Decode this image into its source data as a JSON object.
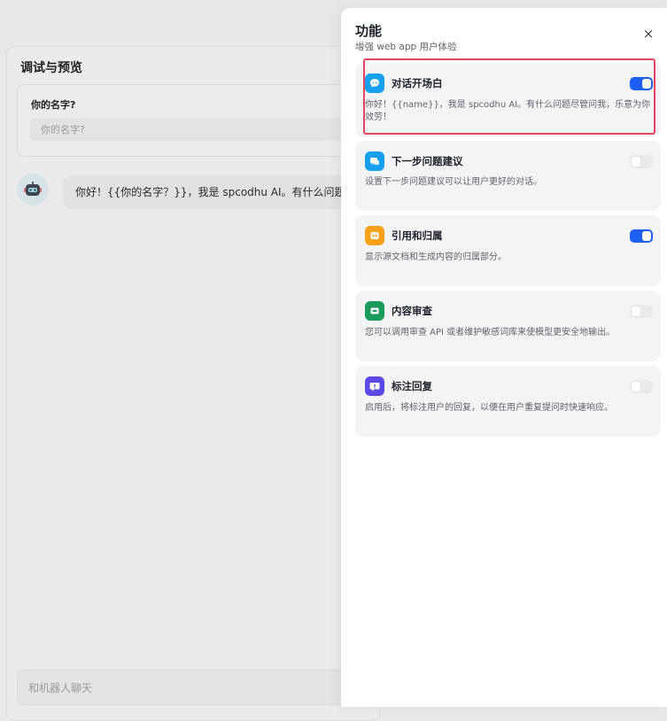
{
  "debug_panel": {
    "title": "调试与预览",
    "variable": {
      "label": "你的名字?",
      "placeholder": "你的名字?"
    },
    "greeting": "你好！{{你的名字？}}，我是 spcodhu AI。有什么问题尽管问我，乐意为你效劳！",
    "chat_placeholder": "和机器人聊天"
  },
  "drawer": {
    "title": "功能",
    "subtitle": "增强 web app 用户体验",
    "close_label": "×",
    "features": [
      {
        "title": "对话开场白",
        "desc": "你好！{{name}}，我是 spcodhu AI。有什么问题尽管问我，乐意为你效劳！",
        "enabled": true,
        "icon": "chat-bubble-icon",
        "color": "#18a0f0"
      },
      {
        "title": "下一步问题建议",
        "desc": "设置下一步问题建议可以让用户更好的对话。",
        "enabled": false,
        "icon": "message-suggest-icon",
        "color": "#18a0f0"
      },
      {
        "title": "引用和归属",
        "desc": "显示源文档和生成内容的归属部分。",
        "enabled": true,
        "icon": "quote-icon",
        "color": "#f7a21a"
      },
      {
        "title": "内容审查",
        "desc": "您可以调用审查 API 或者维护敏感词库来使模型更安全地输出。",
        "enabled": false,
        "icon": "moderation-icon",
        "color": "#1a9b5c"
      },
      {
        "title": "标注回复",
        "desc": "启用后，将标注用户的回复，以便在用户重复提问时快速响应。",
        "enabled": false,
        "icon": "annotation-icon",
        "color": "#5a49e6"
      }
    ]
  }
}
